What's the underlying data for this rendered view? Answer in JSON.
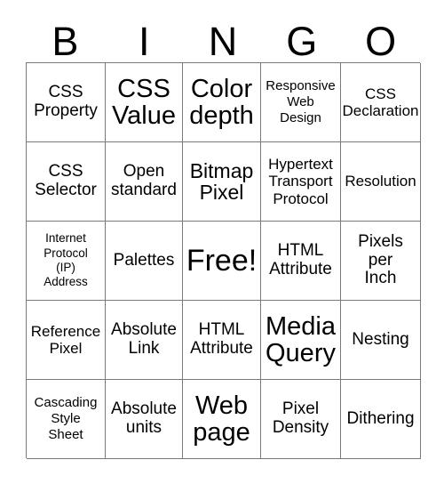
{
  "card": {
    "title": "BINGO",
    "header_letters": [
      "B",
      "I",
      "N",
      "G",
      "O"
    ],
    "free_space_label": "Free!",
    "colors": {
      "grid_line": "#7a7a7a",
      "text": "#000000",
      "background": "#ffffff"
    },
    "rows": [
      [
        {
          "text": "CSS\nProperty",
          "size": "md"
        },
        {
          "text": "CSS\nValue",
          "size": "xl"
        },
        {
          "text": "Color\ndepth",
          "size": "xl"
        },
        {
          "text": "Responsive\nWeb\nDesign",
          "size": "xs"
        },
        {
          "text": "CSS\nDeclaration",
          "size": "sm"
        }
      ],
      [
        {
          "text": "CSS\nSelector",
          "size": "md"
        },
        {
          "text": "Open\nstandard",
          "size": "md"
        },
        {
          "text": "Bitmap\nPixel",
          "size": "lg"
        },
        {
          "text": "Hypertext\nTransport\nProtocol",
          "size": "sm"
        },
        {
          "text": "Resolution",
          "size": "sm"
        }
      ],
      [
        {
          "text": "Internet\nProtocol\n(IP)\nAddress",
          "size": "xxs"
        },
        {
          "text": "Palettes",
          "size": "md"
        },
        {
          "text": "Free!",
          "size": "xxl"
        },
        {
          "text": "HTML\nAttribute",
          "size": "md"
        },
        {
          "text": "Pixels\nper\nInch",
          "size": "md"
        }
      ],
      [
        {
          "text": "Reference\nPixel",
          "size": "sm"
        },
        {
          "text": "Absolute\nLink",
          "size": "md"
        },
        {
          "text": "HTML\nAttribute",
          "size": "md"
        },
        {
          "text": "Media\nQuery",
          "size": "xl"
        },
        {
          "text": "Nesting",
          "size": "md"
        }
      ],
      [
        {
          "text": "Cascading\nStyle\nSheet",
          "size": "xs"
        },
        {
          "text": "Absolute\nunits",
          "size": "md"
        },
        {
          "text": "Web\npage",
          "size": "xl"
        },
        {
          "text": "Pixel\nDensity",
          "size": "md"
        },
        {
          "text": "Dithering",
          "size": "md"
        }
      ]
    ]
  }
}
